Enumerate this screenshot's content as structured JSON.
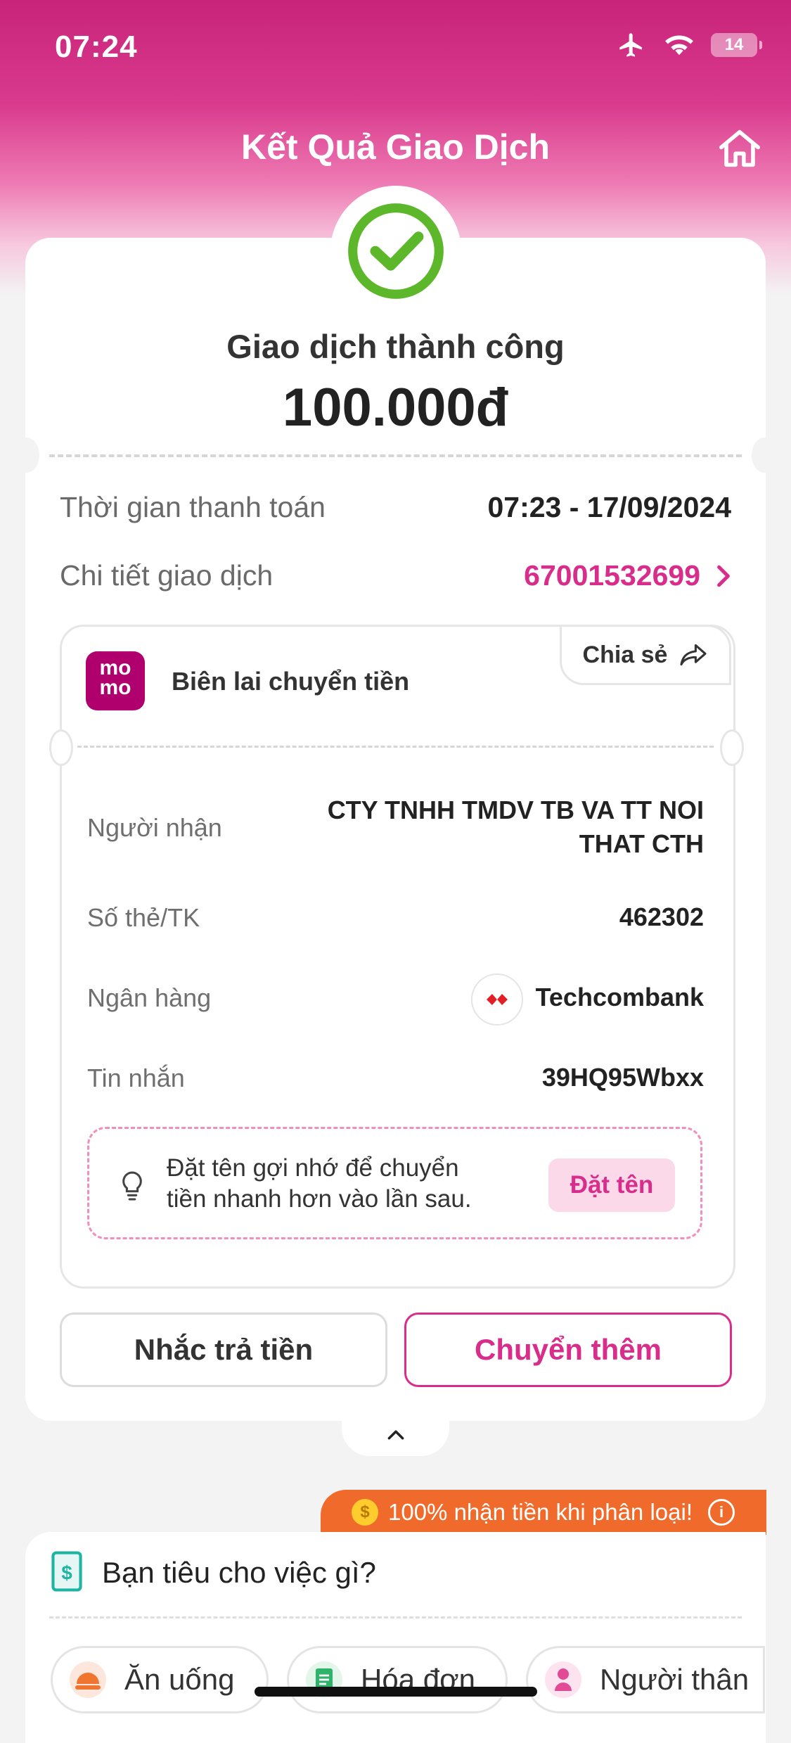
{
  "status_bar": {
    "time": "07:24",
    "battery": "14"
  },
  "header": {
    "title": "Kết Quả Giao Dịch"
  },
  "result": {
    "status_text": "Giao dịch thành công",
    "amount": "100.000đ"
  },
  "info_rows": [
    {
      "label": "Thời gian thanh toán",
      "value": "07:23 - 17/09/2024"
    },
    {
      "label": "Chi tiết giao dịch",
      "value": "67001532699"
    }
  ],
  "receipt": {
    "logo_top": "mo",
    "logo_bottom": "mo",
    "title": "Biên lai chuyển tiền",
    "share_label": "Chia sẻ",
    "details": [
      {
        "label": "Người nhận",
        "value_line1": "CTY TNHH TMDV TB VA TT NOI",
        "value_line2": "THAT CTH"
      },
      {
        "label": "Số thẻ/TK",
        "value": "462302"
      },
      {
        "label": "Ngân hàng",
        "value": "Techcombank"
      },
      {
        "label": "Tin nhắn",
        "value": "39HQ95Wbxx"
      }
    ],
    "nickname": {
      "line1": "Đặt tên gợi nhớ để chuyển",
      "line2": "tiền nhanh hơn vào lần sau.",
      "button": "Đặt tên"
    }
  },
  "actions": {
    "remind": "Nhắc trả tiền",
    "transfer_more": "Chuyển thêm"
  },
  "promo": {
    "text": "100% nhận tiền khi phân loại!"
  },
  "spending": {
    "title": "Bạn tiêu cho việc gì?",
    "categories": [
      {
        "label": "Ăn uống",
        "icon": "food-icon"
      },
      {
        "label": "Hóa đơn",
        "icon": "bill-icon"
      },
      {
        "label": "Người thân",
        "icon": "family-icon"
      }
    ]
  },
  "colors": {
    "brand_pink": "#d82d8b",
    "success_green": "#5cb82a",
    "promo_orange": "#f06b2b"
  }
}
